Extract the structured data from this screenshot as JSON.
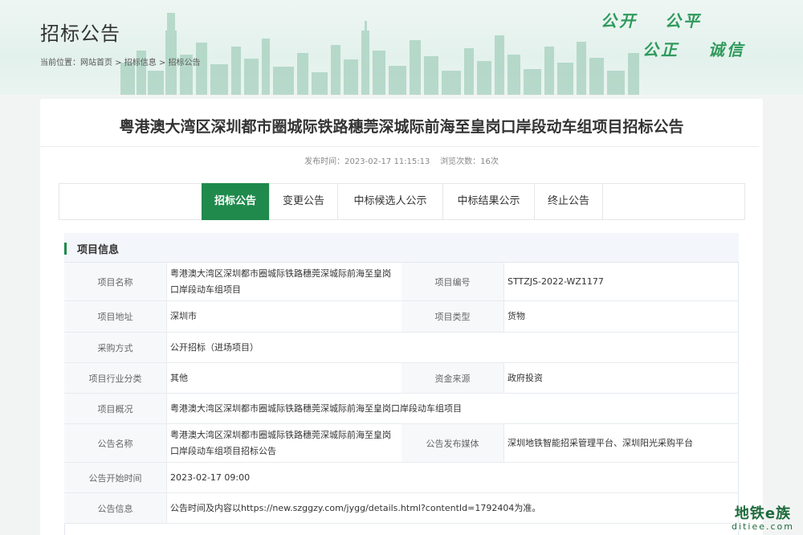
{
  "header": {
    "page_title": "招标公告",
    "breadcrumb": "当前位置：网站首页 > 招标信息 > 招标公告",
    "slogans": [
      "公开",
      "公平",
      "公正",
      "诚信"
    ]
  },
  "announcement": {
    "title": "粤港澳大湾区深圳都市圈城际铁路穗莞深城际前海至皇岗口岸段动车组项目招标公告",
    "meta": "发布时间：2023-02-17 11:15:13    浏览次数：16次"
  },
  "tabs": [
    {
      "label": "招标公告",
      "active": true
    },
    {
      "label": "变更公告",
      "active": false
    },
    {
      "label": "中标候选人公示",
      "active": false
    },
    {
      "label": "中标结果公示",
      "active": false
    },
    {
      "label": "终止公告",
      "active": false
    }
  ],
  "project_info": {
    "heading": "项目信息",
    "project_name_label": "项目名称",
    "project_name": "粤港澳大湾区深圳都市圈城际铁路穗莞深城际前海至皇岗口岸段动车组项目",
    "project_no_label": "项目编号",
    "project_no": "STTZJS-2022-WZ1177",
    "address_label": "项目地址",
    "address": "深圳市",
    "type_label": "项目类型",
    "type": "货物",
    "purchase_label": "采购方式",
    "purchase": "公开招标（进场项目）",
    "industry_label": "项目行业分类",
    "industry": "其他",
    "fund_label": "资金来源",
    "fund": "政府投资",
    "overview_label": "项目概况",
    "overview": "粤港澳大湾区深圳都市圈城际铁路穗莞深城际前海至皇岗口岸段动车组项目",
    "notice_name_label": "公告名称",
    "notice_name": "粤港澳大湾区深圳都市圈城际铁路穗莞深城际前海至皇岗口岸段动车组项目招标公告",
    "media_label": "公告发布媒体",
    "media": "深圳地铁智能招采管理平台、深圳阳光采购平台",
    "start_label": "公告开始时间",
    "start": "2023-02-17 09:00",
    "notice_info_label": "公告信息",
    "notice_info": "公告时间及内容以https://new.szggzy.com/jygg/details.html?contentId=1792404为准。"
  },
  "watermark": {
    "line1": "地铁e族",
    "line2": "ditiee.com"
  },
  "colors": {
    "accent": "#1f8a4c",
    "slogan": "#2f9a5c"
  }
}
